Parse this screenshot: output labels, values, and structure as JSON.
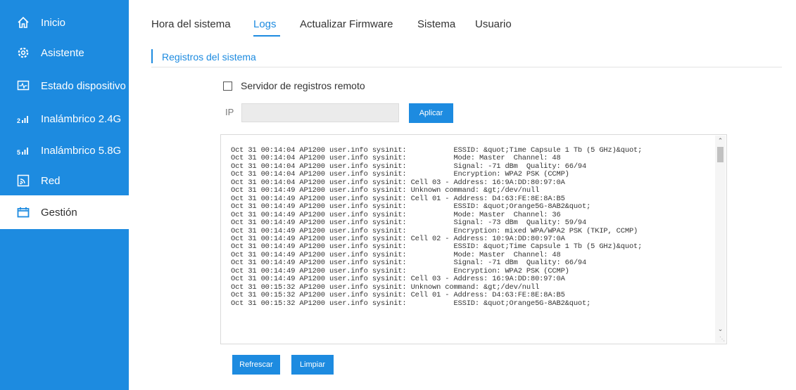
{
  "sidebar": {
    "items": [
      {
        "label": "Inicio",
        "icon": "home-icon"
      },
      {
        "label": "Asistente",
        "icon": "gear-icon"
      },
      {
        "label": "Estado dispositivo",
        "icon": "monitor-icon"
      },
      {
        "label": "Inalámbrico 2.4G",
        "icon": "signal-2g-icon"
      },
      {
        "label": "Inalámbrico 5.8G",
        "icon": "signal-5g-icon"
      },
      {
        "label": "Red",
        "icon": "network-icon"
      },
      {
        "label": "Gestión",
        "icon": "management-icon",
        "active": true
      }
    ]
  },
  "tabs": [
    {
      "label": "Hora del sistema"
    },
    {
      "label": "Logs",
      "active": true
    },
    {
      "label": "Actualizar Firmware"
    },
    {
      "label": "Sistema"
    },
    {
      "label": "Usuario"
    }
  ],
  "section": {
    "title": "Registros del sistema"
  },
  "remote": {
    "label": "Servidor de registros remoto",
    "checked": false
  },
  "ip": {
    "label": "IP",
    "value": "",
    "placeholder": ""
  },
  "buttons": {
    "apply": "Aplicar",
    "refresh": "Refrescar",
    "clear": "Limpiar"
  },
  "log": {
    "lines": [
      "Oct 31 00:14:04 AP1200 user.info sysinit:           ESSID: &quot;Time Capsule 1 Tb (5 GHz)&quot;",
      "Oct 31 00:14:04 AP1200 user.info sysinit:           Mode: Master  Channel: 48",
      "Oct 31 00:14:04 AP1200 user.info sysinit:           Signal: -71 dBm  Quality: 66/94",
      "Oct 31 00:14:04 AP1200 user.info sysinit:           Encryption: WPA2 PSK (CCMP)",
      "Oct 31 00:14:04 AP1200 user.info sysinit: Cell 03 - Address: 16:9A:DD:80:97:0A",
      "Oct 31 00:14:49 AP1200 user.info sysinit: Unknown command: &gt;/dev/null",
      "Oct 31 00:14:49 AP1200 user.info sysinit: Cell 01 - Address: D4:63:FE:8E:8A:B5",
      "Oct 31 00:14:49 AP1200 user.info sysinit:           ESSID: &quot;Orange5G-8AB2&quot;",
      "Oct 31 00:14:49 AP1200 user.info sysinit:           Mode: Master  Channel: 36",
      "Oct 31 00:14:49 AP1200 user.info sysinit:           Signal: -73 dBm  Quality: 59/94",
      "Oct 31 00:14:49 AP1200 user.info sysinit:           Encryption: mixed WPA/WPA2 PSK (TKIP, CCMP)",
      "Oct 31 00:14:49 AP1200 user.info sysinit: Cell 02 - Address: 10:9A:DD:80:97:0A",
      "Oct 31 00:14:49 AP1200 user.info sysinit:           ESSID: &quot;Time Capsule 1 Tb (5 GHz)&quot;",
      "Oct 31 00:14:49 AP1200 user.info sysinit:           Mode: Master  Channel: 48",
      "Oct 31 00:14:49 AP1200 user.info sysinit:           Signal: -71 dBm  Quality: 66/94",
      "Oct 31 00:14:49 AP1200 user.info sysinit:           Encryption: WPA2 PSK (CCMP)",
      "Oct 31 00:14:49 AP1200 user.info sysinit: Cell 03 - Address: 16:9A:DD:80:97:0A",
      "Oct 31 00:15:32 AP1200 user.info sysinit: Unknown command: &gt;/dev/null",
      "Oct 31 00:15:32 AP1200 user.info sysinit: Cell 01 - Address: D4:63:FE:8E:8A:B5",
      "Oct 31 00:15:32 AP1200 user.info sysinit:           ESSID: &quot;Orange5G-8AB2&quot;"
    ]
  },
  "colors": {
    "accent": "#1d8be0",
    "sidebar_bg": "#1d8be0",
    "text": "#333333"
  }
}
